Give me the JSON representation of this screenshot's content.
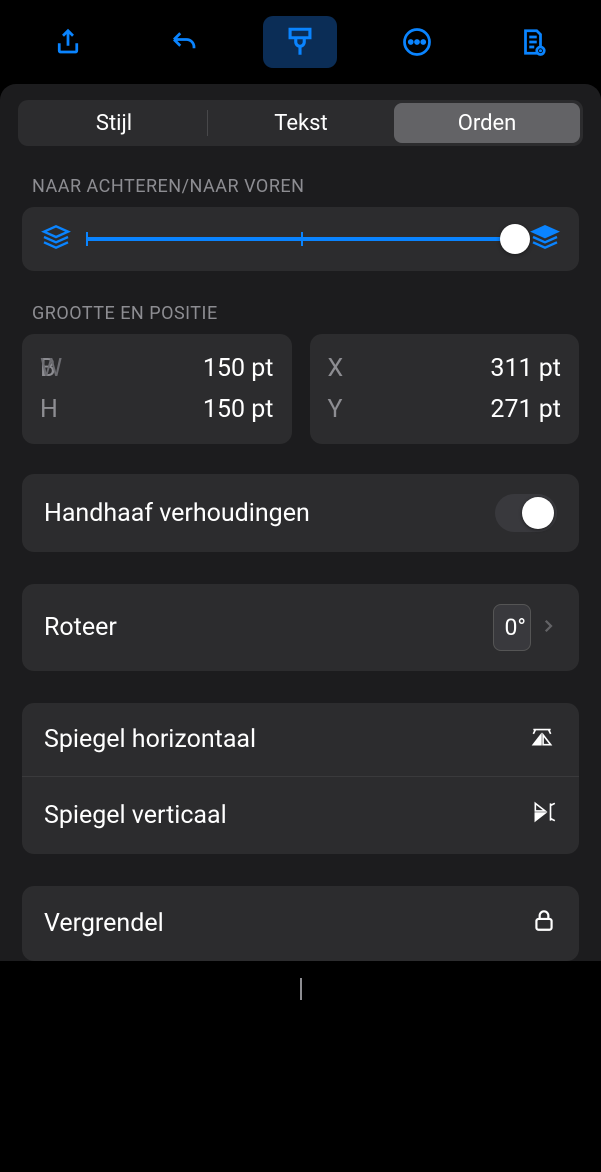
{
  "tabs": {
    "style": "Stijl",
    "text": "Tekst",
    "arrange": "Orden"
  },
  "sections": {
    "layer": {
      "label": "NAAR ACHTEREN/NAAR VOREN",
      "slider_percent": 100
    },
    "size_pos": {
      "label": "GROOTTE EN POSITIE",
      "w_label": "B",
      "w_overlay": "W",
      "h_label": "H",
      "x_label": "X",
      "y_label": "Y",
      "w_value": "150 pt",
      "h_value": "150 pt",
      "x_value": "311 pt",
      "y_value": "271 pt"
    },
    "constrain": {
      "label": "Handhaaf verhoudingen",
      "on": false
    },
    "rotate": {
      "label": "Roteer",
      "value": "0°"
    },
    "flip_h": "Spiegel horizontaal",
    "flip_v": "Spiegel verticaal",
    "lock": "Vergrendel"
  }
}
